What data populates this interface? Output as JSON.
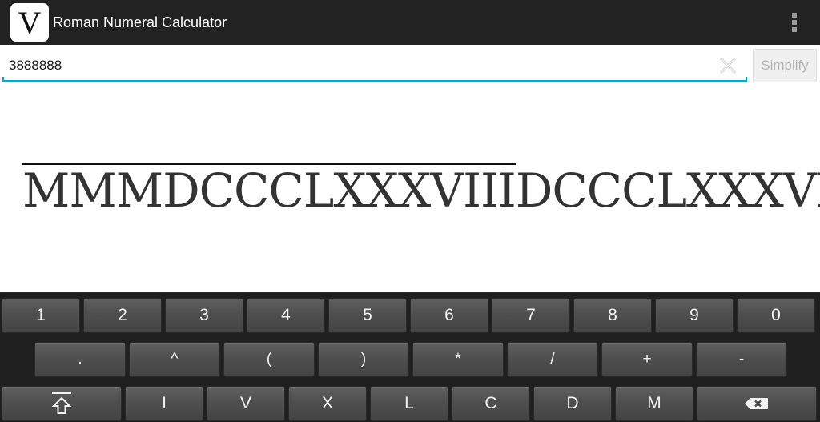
{
  "app": {
    "icon_letter": "V",
    "title": "Roman Numeral Calculator"
  },
  "input": {
    "value": "3888888",
    "placeholder": ""
  },
  "simplify_button": {
    "label": "Simplify",
    "enabled": false
  },
  "result": {
    "overlined_part": "MMMDCCCLXXXVIII",
    "plain_part": "DCCCLXXXVIII",
    "numeral": "MMMDCCCLXXXVIIIDCCCLXXXVIII"
  },
  "keyboard": {
    "row1": [
      "1",
      "2",
      "3",
      "4",
      "5",
      "6",
      "7",
      "8",
      "9",
      "0"
    ],
    "row2": [
      ".",
      "^",
      "(",
      ")",
      "*",
      "/",
      "+",
      "-"
    ],
    "row3": {
      "shift": "shift-bar-icon",
      "numerals": [
        "I",
        "V",
        "X",
        "L",
        "C",
        "D",
        "M"
      ],
      "backspace": "backspace-icon"
    }
  },
  "colors": {
    "accent": "#1ba0bf",
    "actionbar": "#222222",
    "keyboard_bg": "#1e1f1e"
  }
}
